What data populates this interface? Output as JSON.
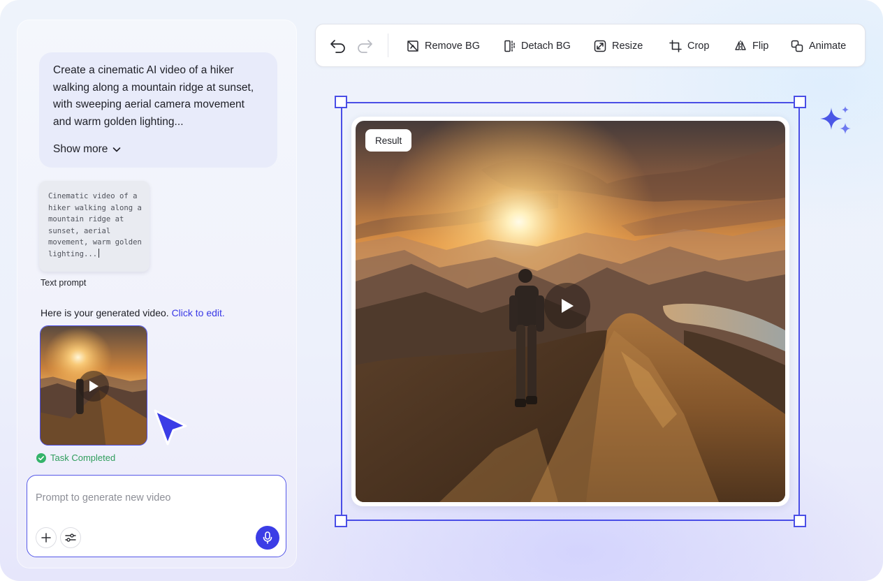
{
  "chat": {
    "user_prompt": "Create a cinematic AI video of a hiker walking along a mountain ridge at sunset, with sweeping aerial camera movement and warm golden lighting...",
    "show_more_label": "Show more",
    "prompt_card": {
      "text": "Cinematic video of a hiker walking along a mountain ridge at sunset, aerial movement, warm golden lighting...",
      "caption": "Text prompt"
    },
    "generated_message": "Here is your generated video.",
    "edit_link": "Click to edit.",
    "status": "Task Completed"
  },
  "composer": {
    "placeholder": "Prompt to generate new video",
    "value": ""
  },
  "toolbar": {
    "undo_icon": "undo-icon",
    "redo_icon": "redo-icon",
    "remove_bg_label": "Remove BG",
    "detach_bg_label": "Detach BG",
    "resize_label": "Resize",
    "crop_label": "Crop",
    "flip_label": "Flip",
    "animate_label": "Animate"
  },
  "canvas": {
    "result_label": "Result"
  },
  "colors": {
    "accent": "#4a4ee6",
    "link": "#3a39e6",
    "success": "#2f9d5c",
    "mic_button": "#3b3de6"
  }
}
